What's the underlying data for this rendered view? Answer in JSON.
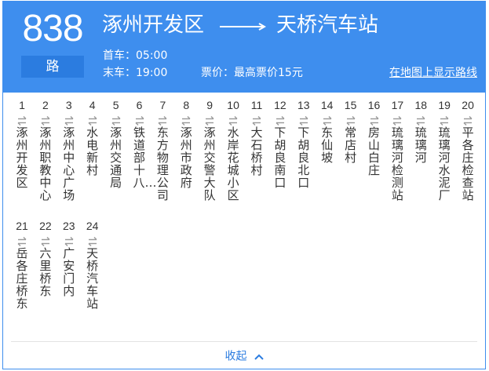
{
  "route": {
    "number": "838",
    "suffix": "路",
    "from": "涿州开发区",
    "to": "天桥汽车站",
    "first_bus": "首车：05:00",
    "last_bus": "末车：19:00",
    "fare": "票价：最高票价15元",
    "map_link": "在地图上显示路线"
  },
  "stops": [
    {
      "num": "1",
      "name": "涿州开发区"
    },
    {
      "num": "2",
      "name": "涿州职教中心"
    },
    {
      "num": "3",
      "name": "涿州中心广场"
    },
    {
      "num": "4",
      "name": "水电新村"
    },
    {
      "num": "5",
      "name": "涿州交通局"
    },
    {
      "num": "6",
      "name": "铁道部十八…"
    },
    {
      "num": "7",
      "name": "东方物理公司"
    },
    {
      "num": "8",
      "name": "涿州市政府"
    },
    {
      "num": "9",
      "name": "涿州交警大队"
    },
    {
      "num": "10",
      "name": "水岸花城小区"
    },
    {
      "num": "11",
      "name": "大石桥村"
    },
    {
      "num": "12",
      "name": "下胡良南口"
    },
    {
      "num": "13",
      "name": "下胡良北口"
    },
    {
      "num": "14",
      "name": "东仙坡"
    },
    {
      "num": "15",
      "name": "常店村"
    },
    {
      "num": "16",
      "name": "房山白庄"
    },
    {
      "num": "17",
      "name": "琉璃河检测站"
    },
    {
      "num": "18",
      "name": "琉璃河"
    },
    {
      "num": "19",
      "name": "琉璃河水泥厂"
    },
    {
      "num": "20",
      "name": "平各庄检查站"
    },
    {
      "num": "21",
      "name": "岳各庄桥东"
    },
    {
      "num": "22",
      "name": "六里桥东"
    },
    {
      "num": "23",
      "name": "广安门内"
    },
    {
      "num": "24",
      "name": "天桥汽车站"
    }
  ],
  "collapse_label": "收起",
  "colors": {
    "header_bg": "#3e8eee",
    "suffix_bg": "#2b7ce0",
    "link": "#2b7ce0",
    "stop_icon": "#9a9a9a"
  }
}
